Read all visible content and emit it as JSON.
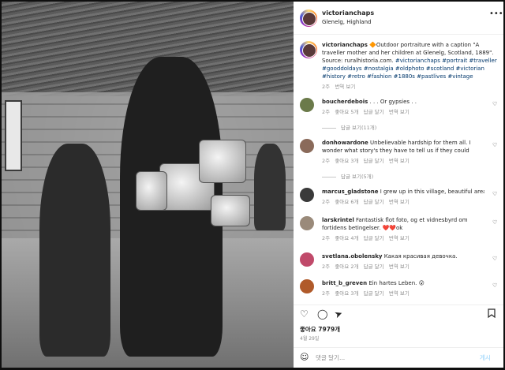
{
  "post": {
    "username": "victorianchaps",
    "location": "Glenelg, Highland",
    "more_icon": "more-icon"
  },
  "caption": {
    "username": "victorianchaps",
    "emoji": "🔶",
    "text_part1": "Outdoor portraiture with a caption \"A traveller mother and her children at Glenelg, Scotland, 1889\". Source: ruralhistoria.com.",
    "hashtags_line1": "#victorianchaps #portrait #traveller",
    "hashtags_line2": "#gooddoldays #nostalgia #oldphoto #scotland #victorian",
    "hashtags_line3": "#history #retro #fashion #1880s #pastlives #vintage",
    "time": "2주",
    "translate": "번역 보기"
  },
  "comments": [
    {
      "user": "boucherdebois",
      "text": ". . . Or gypsies . .",
      "time": "2주",
      "likes": "좋아요 5개",
      "reply": "답글 달기",
      "translate": "번역 보기",
      "replies": "답글 보기(11개)",
      "color": "#6b7a4a"
    },
    {
      "user": "donhowardone",
      "text": "Unbelievable hardship for them all. I wonder what story's they have to tell us if they could",
      "time": "2주",
      "likes": "좋아요 3개",
      "reply": "답글 달기",
      "translate": "번역 보기",
      "replies": "답글 보기(5개)",
      "color": "#8a6a5a"
    },
    {
      "user": "marcus_gladstone",
      "text": "I grew up in this village, beautiful area...",
      "time": "2주",
      "likes": "좋아요 6개",
      "reply": "답글 달기",
      "translate": "번역 보기",
      "color": "#3a3a3a"
    },
    {
      "user": "larskrintel",
      "text": "Fantastisk flot foto, og et vidnesbyrd om fortidens betingelser. ❤️❤️ok",
      "time": "2주",
      "likes": "좋아요 4개",
      "reply": "답글 달기",
      "translate": "번역 보기",
      "color": "#9a8a7a"
    },
    {
      "user": "svetlana.obolensky",
      "text": "Какая красивая девочка.",
      "time": "2주",
      "likes": "좋아요 2개",
      "reply": "답글 달기",
      "translate": "번역 보기",
      "color": "#c04a6a"
    },
    {
      "user": "britt_b_greven",
      "text": "Ein hartes Leben. 😮",
      "time": "2주",
      "likes": "좋아요 3개",
      "reply": "답글 달기",
      "translate": "번역 보기",
      "color": "#b05a2a"
    }
  ],
  "actions": {
    "like_icon": "heart-icon",
    "comment_icon": "comment-icon",
    "share_icon": "share-icon",
    "save_icon": "bookmark-icon"
  },
  "likes_text": "좋아요 7979개",
  "date_text": "4월 29일",
  "add_comment": {
    "emoji_icon": "emoji-icon",
    "placeholder": "댓글 달기...",
    "post_label": "게시"
  }
}
